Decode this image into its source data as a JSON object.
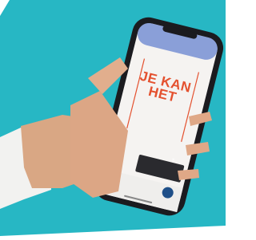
{
  "photo": {
    "background_color": "#27b7c4",
    "phone_frame_color": "#1b1b1f",
    "app_header_color": "#8a9fd8",
    "poster_text_color": "#e4512f"
  },
  "app": {
    "poster_title": "JE KAN HET",
    "toast_text": "",
    "toolbar_labels": [
      "",
      "",
      ""
    ]
  }
}
